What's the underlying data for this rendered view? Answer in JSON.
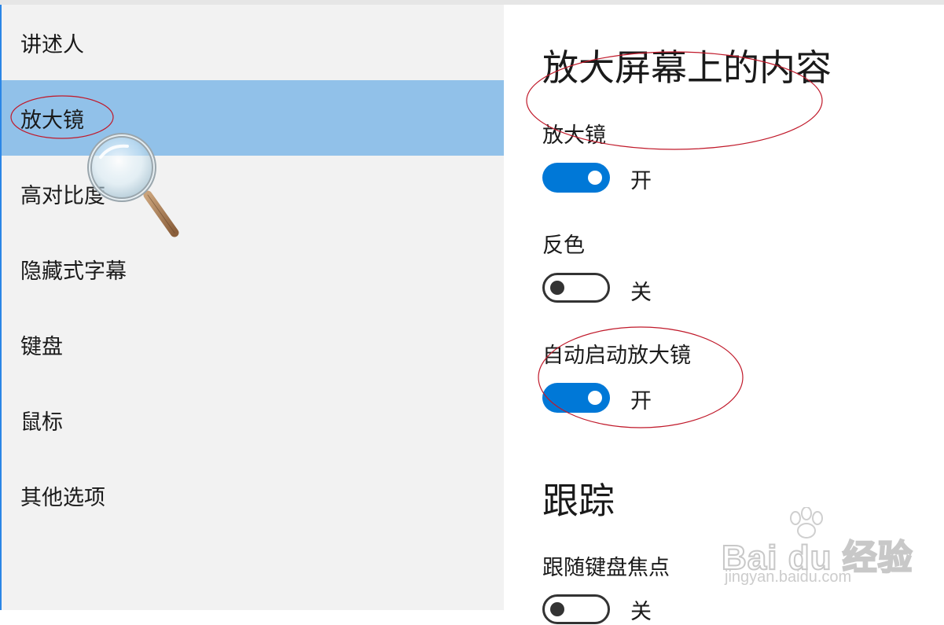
{
  "sidebar": {
    "items": [
      {
        "label": "讲述人"
      },
      {
        "label": "放大镜"
      },
      {
        "label": "高对比度"
      },
      {
        "label": "隐藏式字幕"
      },
      {
        "label": "键盘"
      },
      {
        "label": "鼠标"
      },
      {
        "label": "其他选项"
      }
    ],
    "selected_index": 1
  },
  "main": {
    "title": "放大屏幕上的内容",
    "magnifier": {
      "label": "放大镜",
      "state_label": "开",
      "on": true
    },
    "invert": {
      "label": "反色",
      "state_label": "关",
      "on": false
    },
    "auto_start": {
      "label": "自动启动放大镜",
      "state_label": "开",
      "on": true
    },
    "tracking_title": "跟踪",
    "follow_keyboard": {
      "label": "跟随键盘焦点",
      "state_label": "关",
      "on": false
    }
  },
  "watermark": {
    "brand": "Bai du 经验",
    "url": "jingyan.baidu.com"
  },
  "colors": {
    "accent": "#0078d7",
    "selected_bg": "#91c1e9",
    "sidebar_bg": "#f2f2f2",
    "annotation": "#c0192a"
  },
  "icons": {
    "cursor": "magnifying-glass-cursor-icon",
    "watermark": "paw-icon"
  }
}
